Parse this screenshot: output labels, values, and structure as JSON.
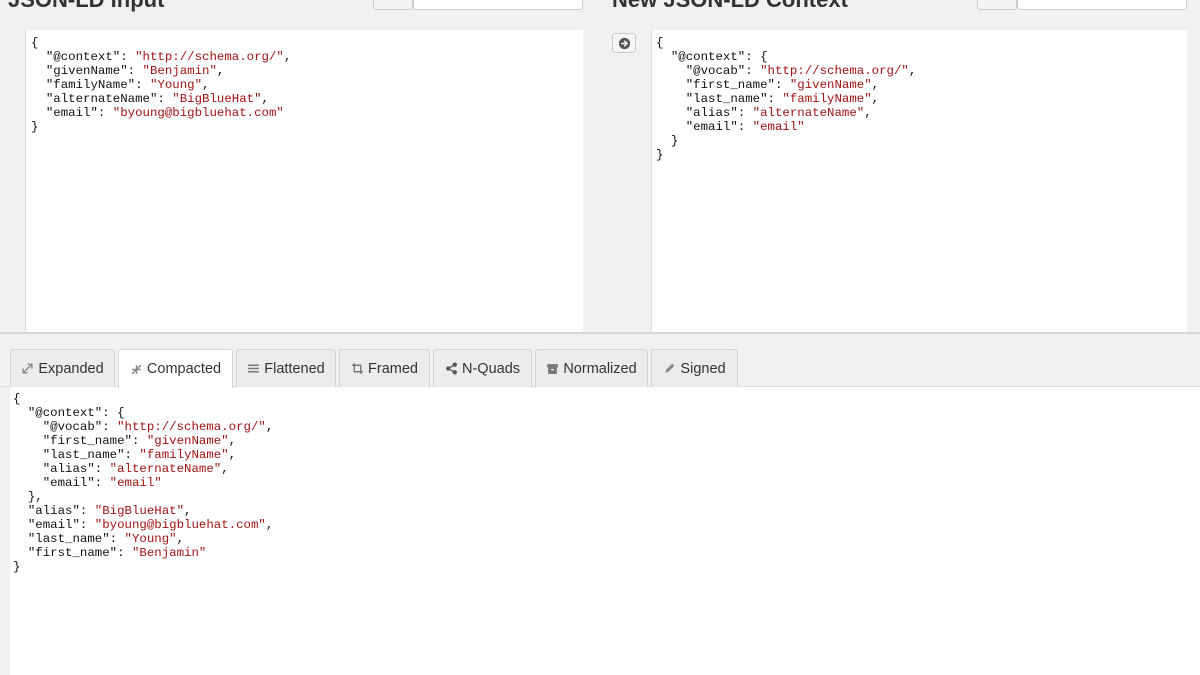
{
  "headings": {
    "input": "JSON-LD Input",
    "context": "New JSON-LD Context"
  },
  "input_code": [
    [
      {
        "t": "{"
      }
    ],
    [
      {
        "t": "  \"@context\": "
      },
      {
        "t": "\"http://schema.org/\"",
        "s": 1
      },
      {
        "t": ","
      }
    ],
    [
      {
        "t": "  \"givenName\": "
      },
      {
        "t": "\"Benjamin\"",
        "s": 1
      },
      {
        "t": ","
      }
    ],
    [
      {
        "t": "  \"familyName\": "
      },
      {
        "t": "\"Young\"",
        "s": 1
      },
      {
        "t": ","
      }
    ],
    [
      {
        "t": "  \"alternateName\": "
      },
      {
        "t": "\"BigBlueHat\"",
        "s": 1
      },
      {
        "t": ","
      }
    ],
    [
      {
        "t": "  \"email\": "
      },
      {
        "t": "\"byoung@bigbluehat.com\"",
        "s": 1
      }
    ],
    [
      {
        "t": "}"
      }
    ]
  ],
  "context_code": [
    [
      {
        "t": "{"
      }
    ],
    [
      {
        "t": "  \"@context\": {"
      }
    ],
    [
      {
        "t": "    \"@vocab\": "
      },
      {
        "t": "\"http://schema.org/\"",
        "s": 1
      },
      {
        "t": ","
      }
    ],
    [
      {
        "t": "    \"first_name\": "
      },
      {
        "t": "\"givenName\"",
        "s": 1
      },
      {
        "t": ","
      }
    ],
    [
      {
        "t": "    \"last_name\": "
      },
      {
        "t": "\"familyName\"",
        "s": 1
      },
      {
        "t": ","
      }
    ],
    [
      {
        "t": "    \"alias\": "
      },
      {
        "t": "\"alternateName\"",
        "s": 1
      },
      {
        "t": ","
      }
    ],
    [
      {
        "t": "    \"email\": "
      },
      {
        "t": "\"email\"",
        "s": 1
      }
    ],
    [
      {
        "t": "  }"
      }
    ],
    [
      {
        "t": "}"
      }
    ]
  ],
  "tabs": [
    {
      "label": "Expanded",
      "icon": "expand-arrow-icon",
      "active": false
    },
    {
      "label": "Compacted",
      "icon": "compress-arrow-icon",
      "active": true
    },
    {
      "label": "Flattened",
      "icon": "flatten-lines-icon",
      "active": false
    },
    {
      "label": "Framed",
      "icon": "crop-icon",
      "active": false
    },
    {
      "label": "N-Quads",
      "icon": "share-nodes-icon",
      "active": false
    },
    {
      "label": "Normalized",
      "icon": "archive-box-icon",
      "active": false
    },
    {
      "label": "Signed",
      "icon": "pencil-icon",
      "active": false
    }
  ],
  "output_code": [
    [
      {
        "t": "{"
      }
    ],
    [
      {
        "t": "  \"@context\": {"
      }
    ],
    [
      {
        "t": "    \"@vocab\": "
      },
      {
        "t": "\"http://schema.org/\"",
        "s": 1
      },
      {
        "t": ","
      }
    ],
    [
      {
        "t": "    \"first_name\": "
      },
      {
        "t": "\"givenName\"",
        "s": 1
      },
      {
        "t": ","
      }
    ],
    [
      {
        "t": "    \"last_name\": "
      },
      {
        "t": "\"familyName\"",
        "s": 1
      },
      {
        "t": ","
      }
    ],
    [
      {
        "t": "    \"alias\": "
      },
      {
        "t": "\"alternateName\"",
        "s": 1
      },
      {
        "t": ","
      }
    ],
    [
      {
        "t": "    \"email\": "
      },
      {
        "t": "\"email\"",
        "s": 1
      }
    ],
    [
      {
        "t": "  },"
      }
    ],
    [
      {
        "t": "  \"alias\": "
      },
      {
        "t": "\"BigBlueHat\"",
        "s": 1
      },
      {
        "t": ","
      }
    ],
    [
      {
        "t": "  \"email\": "
      },
      {
        "t": "\"byoung@bigbluehat.com\"",
        "s": 1
      },
      {
        "t": ","
      }
    ],
    [
      {
        "t": "  \"last_name\": "
      },
      {
        "t": "\"Young\"",
        "s": 1
      },
      {
        "t": ","
      }
    ],
    [
      {
        "t": "  \"first_name\": "
      },
      {
        "t": "\"Benjamin\"",
        "s": 1
      }
    ],
    [
      {
        "t": "}"
      }
    ]
  ],
  "colors": {
    "string": "#a11313",
    "tab_bg": "#ececec",
    "tab_active_bg": "#ffffff"
  }
}
